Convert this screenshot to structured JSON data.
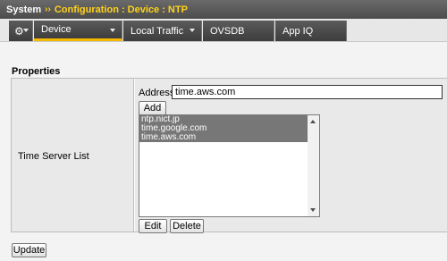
{
  "header": {
    "root": "System",
    "separator": "››",
    "path": "Configuration : Device : NTP"
  },
  "tabs": [
    {
      "label": "",
      "icon": "gear-icon",
      "active": false
    },
    {
      "label": "Device",
      "active": true
    },
    {
      "label": "Local Traffic",
      "active": false
    },
    {
      "label": "OVSDB",
      "active": false
    },
    {
      "label": "App IQ",
      "active": false
    }
  ],
  "properties": {
    "title": "Properties",
    "row_label": "Time Server List",
    "address_label": "Address:",
    "address_value": "time.aws.com",
    "add_label": "Add",
    "servers": [
      "ntp.nict.jp",
      "time.google.com",
      "time.aws.com"
    ],
    "edit_label": "Edit",
    "delete_label": "Delete"
  },
  "footer": {
    "update_label": "Update"
  },
  "colors": {
    "accent": "#f5b800",
    "header_bg": "#4c4c4c",
    "selected_item_bg": "#777777"
  }
}
